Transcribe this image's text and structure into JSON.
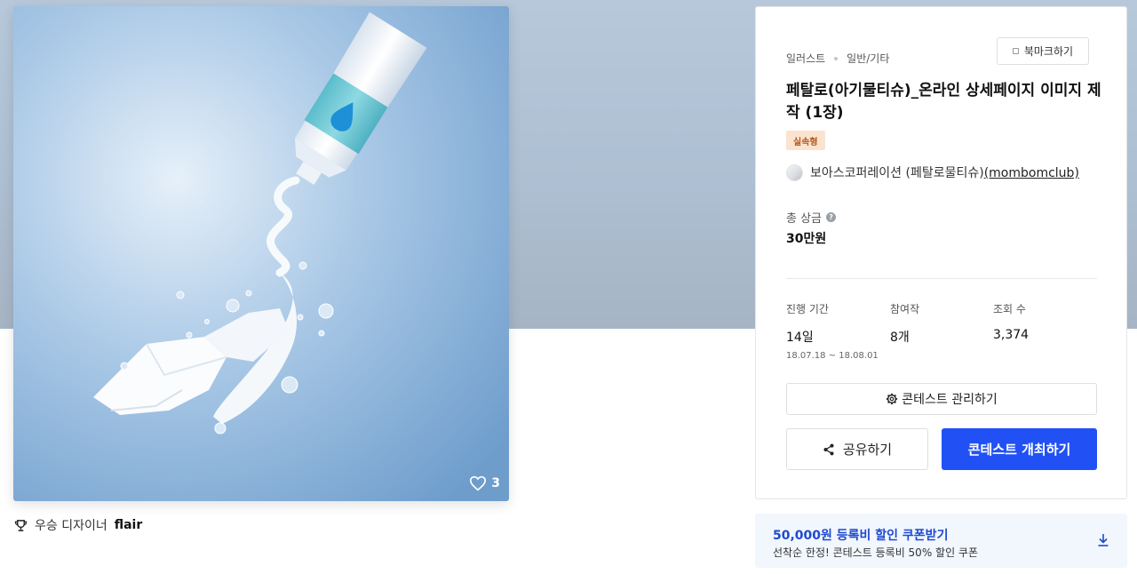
{
  "artwork": {
    "alt": "",
    "like_count": "3"
  },
  "winner": {
    "label": "우승 디자이너",
    "name": "flair"
  },
  "contest": {
    "breadcrumb": [
      "일러스트",
      "일반/기타"
    ],
    "bookmark_label": "북마크하기",
    "title": "페탈로(아기물티슈)_온라인 상세페이지 이미지 제작 (1장)",
    "badge": "실속형",
    "host_name": "보아스코퍼레이션 (페탈로물티슈)",
    "host_handle": "(mombomclub)",
    "prize_label": "총 상금",
    "prize_help": "?",
    "prize_value": "30만원",
    "stats": [
      {
        "label": "진행 기간",
        "value": "14일",
        "sub": "18.07.18 ~ 18.08.01"
      },
      {
        "label": "참여작",
        "value": "8개",
        "sub": ""
      },
      {
        "label": "조회 수",
        "value": "3,374",
        "sub": ""
      }
    ],
    "manage_label": "콘테스트 관리하기",
    "share_label": "공유하기",
    "host_button_label": "콘테스트 개최하기"
  },
  "coupon": {
    "title": "50,000원 등록비 할인 쿠폰받기",
    "subtitle": "선착순 한정! 콘테스트 등록비 50% 할인 쿠폰"
  },
  "colors": {
    "primary": "#2151f5",
    "coupon_text": "#1d4ad0",
    "badge_bg": "#fbe3cf",
    "badge_text": "#b2591f",
    "hero_bg": "#b6c8da"
  },
  "icons": [
    "heart-icon",
    "trophy-icon",
    "bookmark-icon",
    "help-icon",
    "gear-icon",
    "share-icon",
    "download-icon"
  ]
}
